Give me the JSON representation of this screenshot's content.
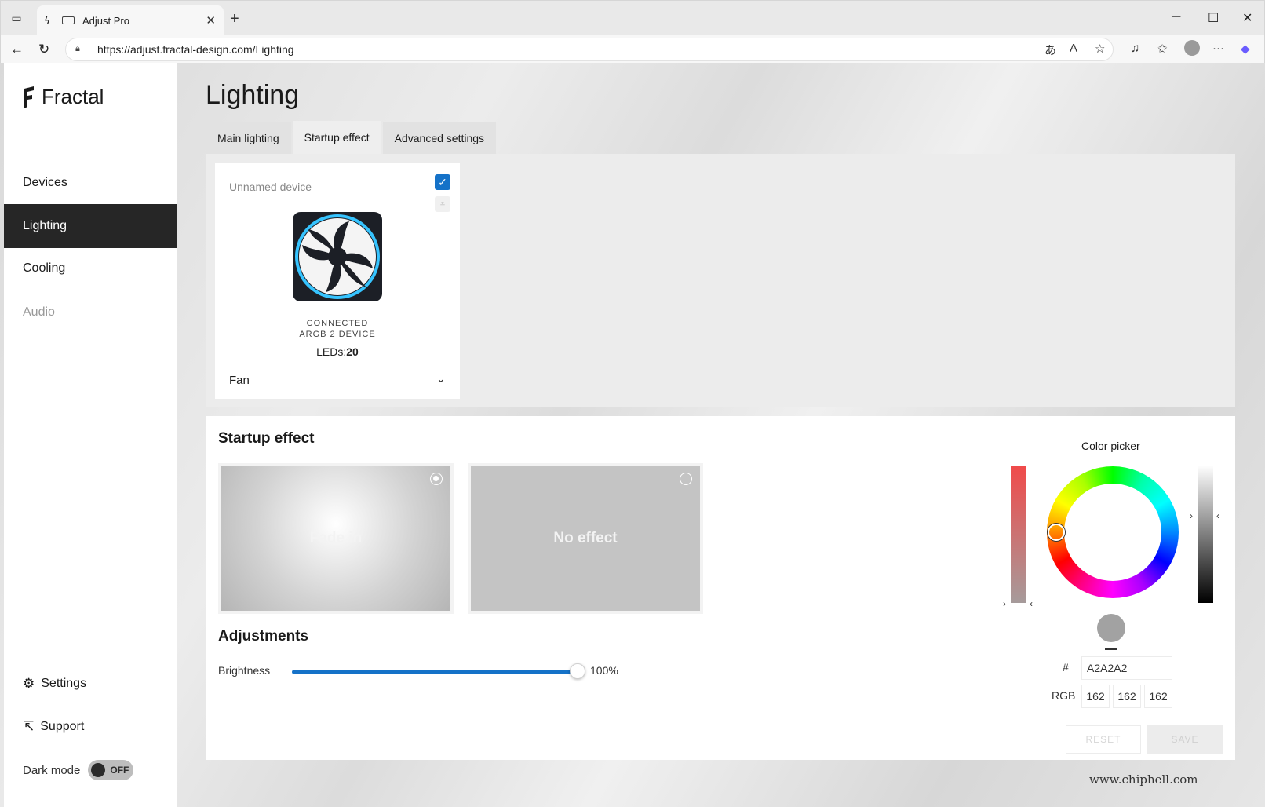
{
  "browser": {
    "tab_title": "Adjust Pro",
    "url": "https://adjust.fractal-design.com/Lighting"
  },
  "sidebar": {
    "brand": "Fractal",
    "items": [
      {
        "label": "Devices",
        "state": "normal"
      },
      {
        "label": "Lighting",
        "state": "active"
      },
      {
        "label": "Cooling",
        "state": "normal"
      },
      {
        "label": "Audio",
        "state": "disabled"
      }
    ],
    "settings_label": "Settings",
    "support_label": "Support",
    "dark_mode_label": "Dark mode",
    "dark_mode_state": "OFF"
  },
  "page": {
    "title": "Lighting",
    "tabs": [
      {
        "label": "Main lighting",
        "active": false
      },
      {
        "label": "Startup effect",
        "active": true
      },
      {
        "label": "Advanced settings",
        "active": false
      }
    ]
  },
  "device": {
    "name": "Unnamed device",
    "checked": true,
    "status_line1": "CONNECTED",
    "status_line2": "ARGB 2 DEVICE",
    "leds_label": "LEDs:",
    "leds_count": "20",
    "type": "Fan"
  },
  "startup": {
    "heading": "Startup effect",
    "effects": [
      {
        "label": "Fade in",
        "selected": true
      },
      {
        "label": "No effect",
        "selected": false
      }
    ]
  },
  "adjustments": {
    "heading": "Adjustments",
    "brightness_label": "Brightness",
    "brightness_value": "100%",
    "brightness_fraction": 1.0
  },
  "color_picker": {
    "title": "Color picker",
    "hash": "#",
    "hex": "A2A2A2",
    "rgb_label": "RGB",
    "r": "162",
    "g": "162",
    "b": "162",
    "swatch_color": "#a2a2a2",
    "reset_label": "RESET",
    "save_label": "SAVE"
  },
  "watermark": "www.chiphell.com",
  "colors": {
    "accent": "#1572c8",
    "sidebar_active": "#262626"
  }
}
